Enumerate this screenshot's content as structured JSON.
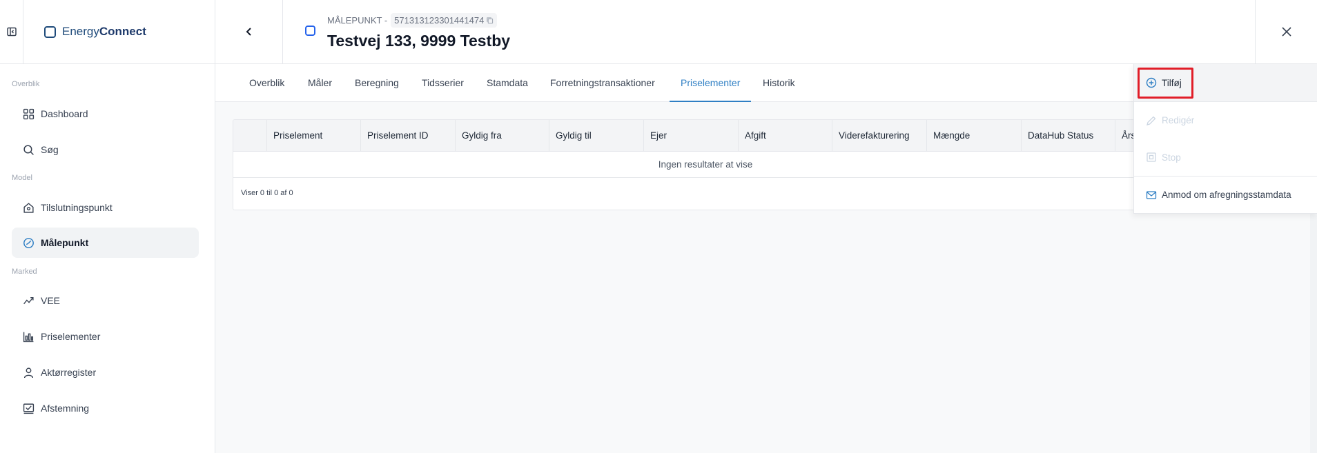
{
  "brand": {
    "prefix": "Energy",
    "bold": "Connect"
  },
  "sidebar": {
    "sections": {
      "overblik": "Overblik",
      "model": "Model",
      "marked": "Marked"
    },
    "items": [
      {
        "label": "Dashboard",
        "icon": "grid-icon"
      },
      {
        "label": "Søg",
        "icon": "search-icon"
      },
      {
        "label": "Tilslutningspunkt",
        "icon": "building-icon"
      },
      {
        "label": "Målepunkt",
        "icon": "gauge-icon",
        "active": true
      },
      {
        "label": "VEE",
        "icon": "trend-icon"
      },
      {
        "label": "Priselementer",
        "icon": "chart-bars-icon"
      },
      {
        "label": "Aktørregister",
        "icon": "user-icon"
      },
      {
        "label": "Afstemning",
        "icon": "check-square-icon"
      }
    ]
  },
  "header": {
    "type_label": "MÅLEPUNKT -",
    "id": "571313123301441474",
    "title": "Testvej 133, 9999 Testby"
  },
  "tabs": [
    "Overblik",
    "Måler",
    "Beregning",
    "Tidsserier",
    "Stamdata",
    "Forretningstransaktioner",
    "Priselementer",
    "Historik"
  ],
  "active_tab": "Priselementer",
  "table": {
    "columns": [
      "Priselement",
      "Priselement ID",
      "Gyldig fra",
      "Gyldig til",
      "Ejer",
      "Afgift",
      "Viderefakturering",
      "Mængde",
      "DataHub Status",
      "Års"
    ],
    "empty_text": "Ingen resultater at vise",
    "footer": "Viser 0 til 0 af 0"
  },
  "menu": {
    "add": "Tilføj",
    "edit": "Redigér",
    "stop": "Stop",
    "request": "Anmod om afregningsstamdata"
  },
  "colors": {
    "accent": "#2f7fc4",
    "brand": "#1e4a7a",
    "highlight": "#e11d28"
  }
}
